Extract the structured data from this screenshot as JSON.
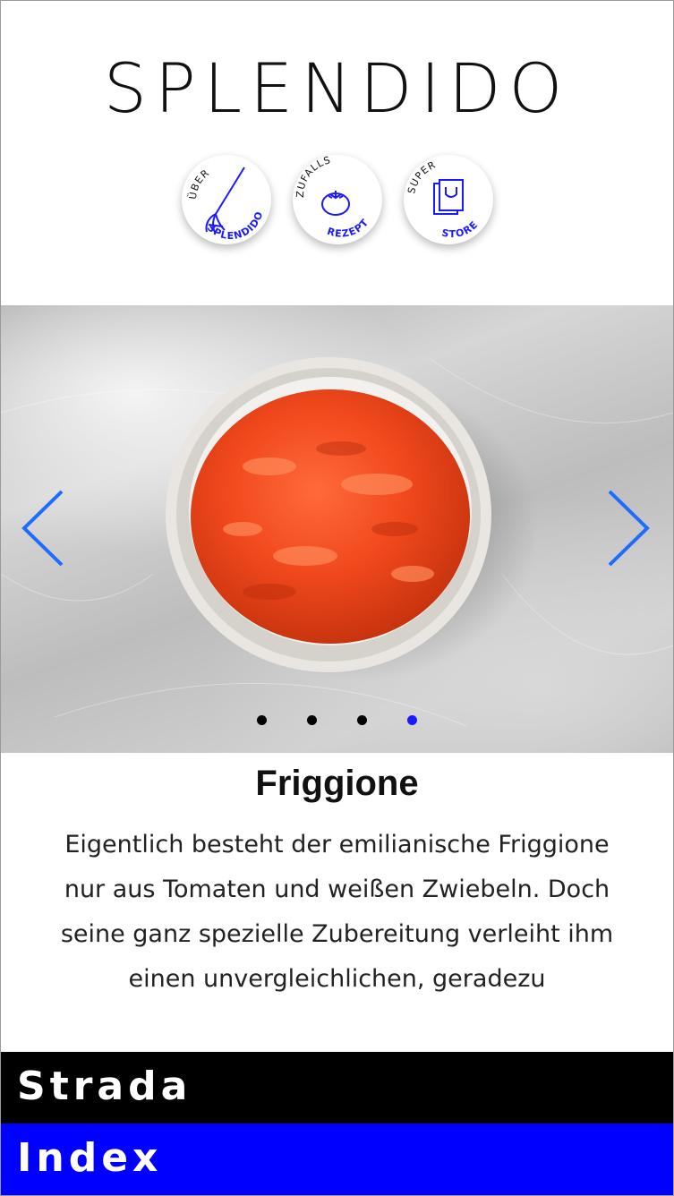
{
  "header": {
    "logo_text": "SPLENDIDO"
  },
  "badges": [
    {
      "top_text": "ÜBER",
      "bottom_text": "SPLENDIDO",
      "icon": "whisk-icon"
    },
    {
      "top_text": "ZUFALLS",
      "bottom_text": "REZEPT",
      "icon": "tomato-icon"
    },
    {
      "top_text": "SUPER",
      "bottom_text": "STORE",
      "icon": "shopping-bag-icon"
    }
  ],
  "carousel": {
    "slide_count": 4,
    "active_index": 3,
    "prev_icon": "chevron-left-icon",
    "next_icon": "chevron-right-icon"
  },
  "recipe": {
    "title": "Friggione",
    "description": "Eigentlich besteht der emilianische Friggione nur aus Tomaten und weißen Zwiebeln. Doch seine ganz spezielle Zubereitung verleiht ihm einen unvergleichlichen, geradezu"
  },
  "bottom_nav": {
    "strada_label": "Strada",
    "index_label": "Index"
  },
  "colors": {
    "accent_blue": "#1a1aff",
    "index_bar": "#0000ff",
    "strada_bar": "#000000",
    "arrow_blue": "#1e6bff"
  }
}
